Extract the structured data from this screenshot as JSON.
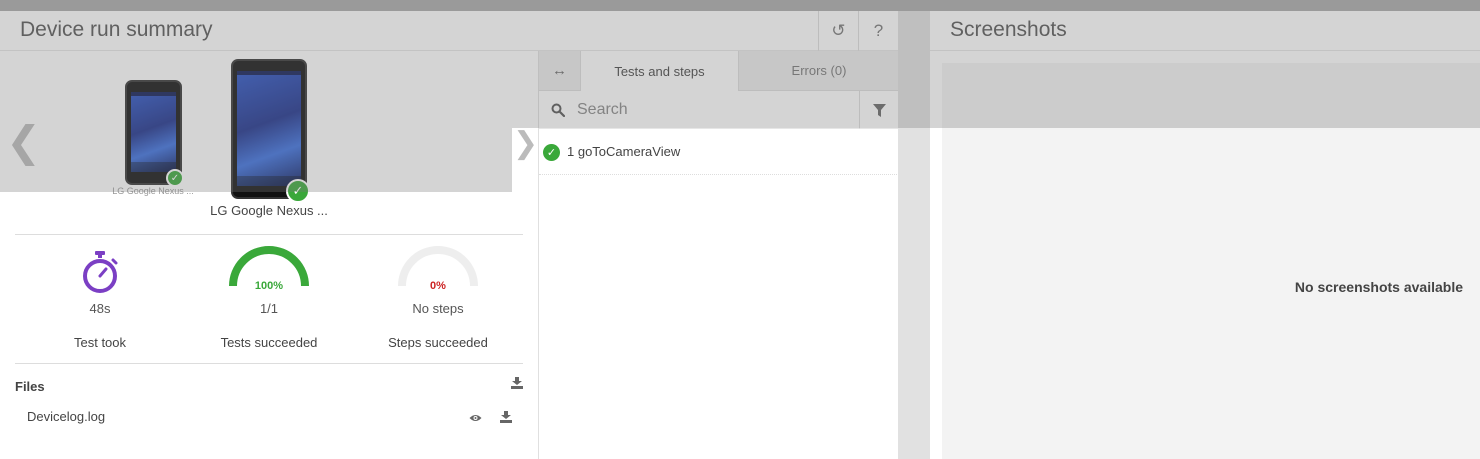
{
  "summary": {
    "title": "Device run summary",
    "refresh_icon": "refresh-icon",
    "help_label": "?"
  },
  "devices": [
    {
      "name": "LG Google Nexus ...",
      "status": "passed"
    },
    {
      "name": "LG Google Nexus ...",
      "status": "passed"
    }
  ],
  "stats": {
    "duration": {
      "value": "48s",
      "label": "Test took",
      "icon": "stopwatch-icon"
    },
    "tests": {
      "percent": "100%",
      "fraction": 1.0,
      "value": "1/1",
      "label": "Tests succeeded",
      "color": "#3aa83a"
    },
    "steps": {
      "percent": "0%",
      "fraction": 0.0,
      "value": "No steps",
      "label": "Steps succeeded",
      "color": "#cc2222"
    }
  },
  "files": {
    "title": "Files",
    "items": [
      {
        "name": "Devicelog.log"
      }
    ]
  },
  "tabs": [
    {
      "label": "Tests and steps",
      "active": true
    },
    {
      "label": "Errors (0)",
      "active": false
    }
  ],
  "search": {
    "placeholder": "Search",
    "value": ""
  },
  "tests": [
    {
      "label": "1 goToCameraView",
      "status": "passed"
    }
  ],
  "screenshots": {
    "title": "Screenshots",
    "empty_text": "No screenshots available"
  },
  "colors": {
    "accent_purple": "#7b3fc4",
    "success_green": "#3aa83a",
    "fail_red": "#cc2222"
  }
}
